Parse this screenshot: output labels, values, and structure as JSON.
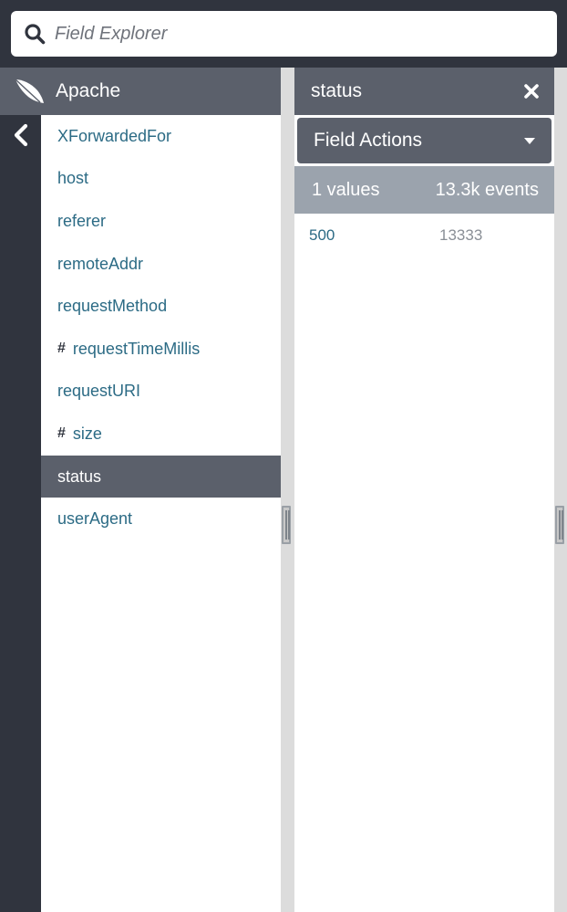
{
  "search": {
    "placeholder": "Field Explorer"
  },
  "source": {
    "title": "Apache",
    "icon": "feather-icon"
  },
  "fields": [
    {
      "label": "XForwardedFor",
      "numeric": false,
      "selected": false
    },
    {
      "label": "host",
      "numeric": false,
      "selected": false
    },
    {
      "label": "referer",
      "numeric": false,
      "selected": false
    },
    {
      "label": "remoteAddr",
      "numeric": false,
      "selected": false
    },
    {
      "label": "requestMethod",
      "numeric": false,
      "selected": false
    },
    {
      "label": "requestTimeMillis",
      "numeric": true,
      "selected": false
    },
    {
      "label": "requestURI",
      "numeric": false,
      "selected": false
    },
    {
      "label": "size",
      "numeric": true,
      "selected": false
    },
    {
      "label": "status",
      "numeric": false,
      "selected": true
    },
    {
      "label": "userAgent",
      "numeric": false,
      "selected": false
    }
  ],
  "numeric_marker": "#",
  "detail": {
    "title": "status",
    "actions_label": "Field Actions",
    "values_count": "1 values",
    "events_count": "13.3k events",
    "values": [
      {
        "value": "500",
        "count": "13333"
      }
    ]
  },
  "colors": {
    "dark_bg": "#30343e",
    "header_bg": "#5b606b",
    "summary_bg": "#9ba3ad",
    "link": "#2c6b85"
  }
}
